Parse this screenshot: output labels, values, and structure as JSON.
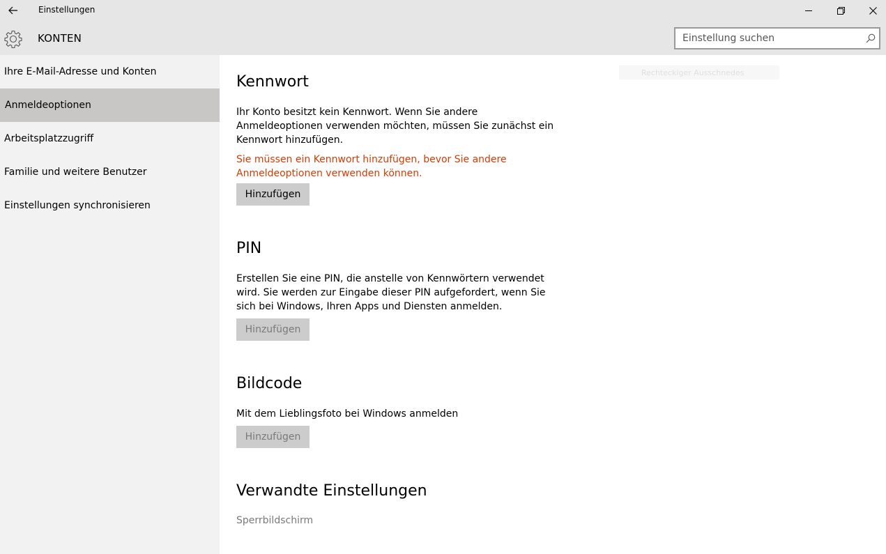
{
  "window": {
    "title": "Einstellungen"
  },
  "header": {
    "section_title": "KONTEN",
    "search_placeholder": "Einstellung suchen"
  },
  "sidebar": {
    "items": [
      {
        "label": "Ihre E-Mail-Adresse und Konten",
        "active": false
      },
      {
        "label": "Anmeldeoptionen",
        "active": true
      },
      {
        "label": "Arbeitsplatzzugriff",
        "active": false
      },
      {
        "label": "Familie und weitere Benutzer",
        "active": false
      },
      {
        "label": "Einstellungen synchronisieren",
        "active": false
      }
    ]
  },
  "ghost_overlay": "Rechteckiger Ausschnedes",
  "main": {
    "kennwort": {
      "heading": "Kennwort",
      "description": "Ihr Konto besitzt kein Kennwort. Wenn Sie andere Anmeldeoptionen verwenden möchten, müssen Sie zunächst ein Kennwort hinzufügen.",
      "warning": "Sie müssen ein Kennwort hinzufügen, bevor Sie andere Anmeldeoptionen verwenden können.",
      "button": "Hinzufügen"
    },
    "pin": {
      "heading": "PIN",
      "description": "Erstellen Sie eine PIN, die anstelle von Kennwörtern verwendet wird. Sie werden zur Eingabe dieser PIN aufgefordert, wenn Sie sich bei Windows, Ihren Apps und Diensten anmelden.",
      "button": "Hinzufügen"
    },
    "bildcode": {
      "heading": "Bildcode",
      "description": "Mit dem Lieblingsfoto bei Windows anmelden",
      "button": "Hinzufügen"
    },
    "related": {
      "heading": "Verwandte Einstellungen",
      "link": "Sperrbildschirm"
    }
  },
  "colors": {
    "warning": "#d83b01",
    "active_nav": "#c9c7c6",
    "chrome": "#e6e6e6"
  }
}
